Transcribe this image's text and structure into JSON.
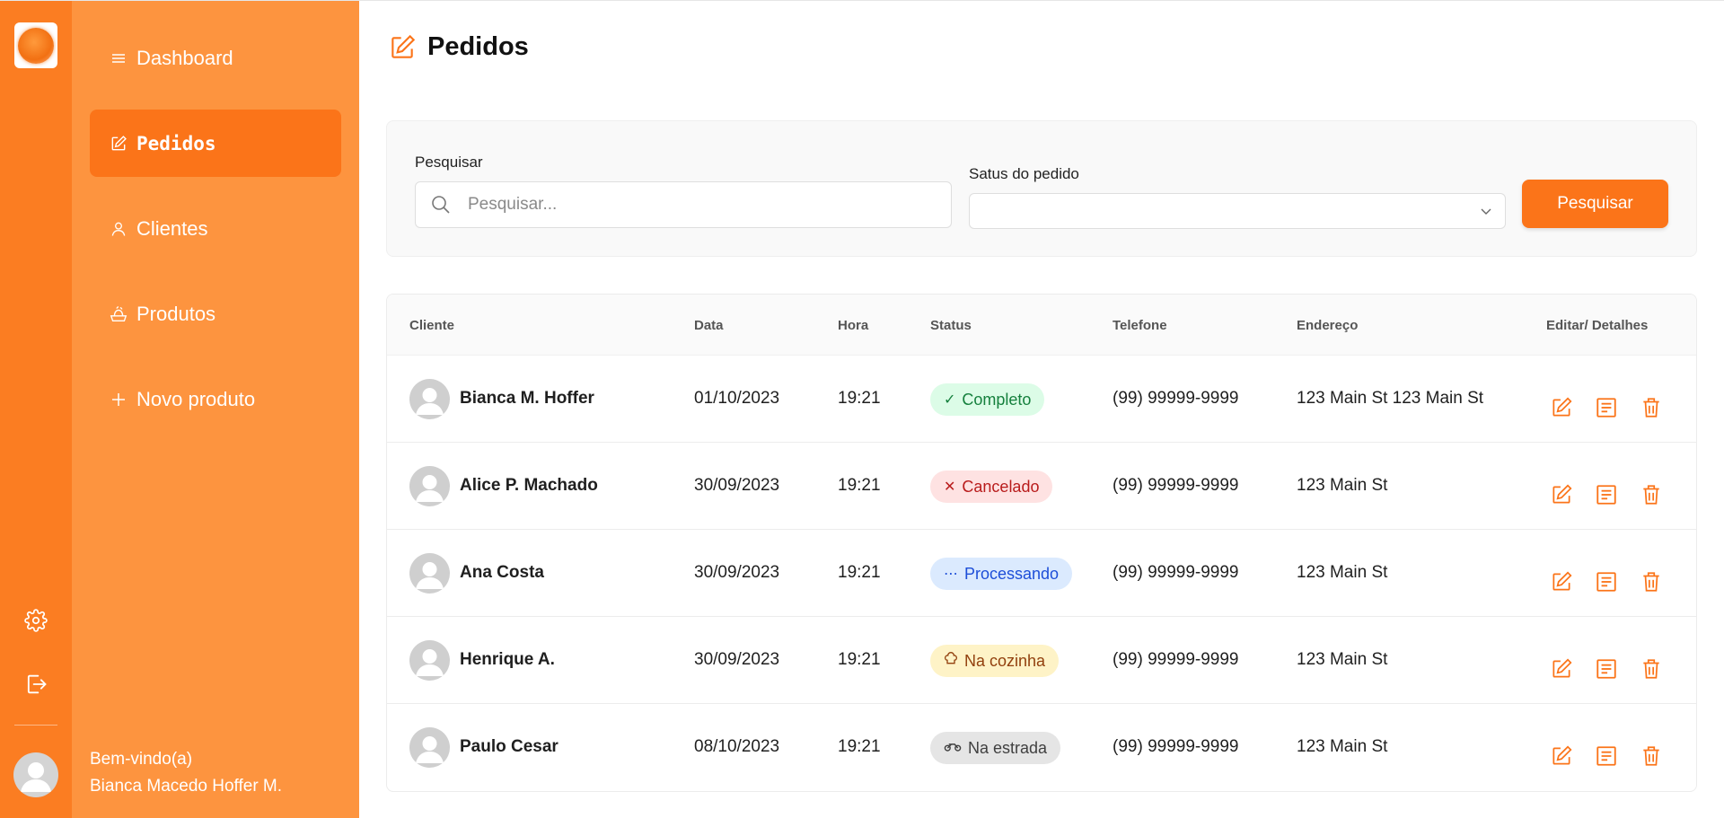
{
  "rail": {
    "icons": [
      "logo",
      "gear-icon",
      "logout-icon",
      "avatar"
    ]
  },
  "sidebar": {
    "items": [
      {
        "label": "Dashboard",
        "icon": "menu-icon"
      },
      {
        "label": "Pedidos",
        "icon": "edit-icon",
        "active": true
      },
      {
        "label": "Clientes",
        "icon": "user-icon"
      },
      {
        "label": "Produtos",
        "icon": "food-icon"
      },
      {
        "label": "Novo produto",
        "icon": "plus-icon"
      }
    ],
    "welcome": "Bem-vindo(a)",
    "user_name": "Bianca Macedo Hoffer M."
  },
  "page": {
    "title": "Pedidos"
  },
  "search": {
    "label": "Pesquisar",
    "placeholder": "Pesquisar...",
    "value": "",
    "status_label": "Satus do pedido",
    "status_value": "",
    "button_label": "Pesquisar"
  },
  "table": {
    "headers": {
      "cliente": "Cliente",
      "data": "Data",
      "hora": "Hora",
      "status": "Status",
      "telefone": "Telefone",
      "endereco": "Endereço",
      "acoes": "Editar/ Detalhes"
    },
    "rows": [
      {
        "cliente": "Bianca M. Hoffer",
        "data": "01/10/2023",
        "hora": "19:21",
        "status": "Completo",
        "status_symbol": "✓",
        "telefone": "(99) 99999-9999",
        "endereco": "123 Main St 123 Main St"
      },
      {
        "cliente": "Alice P. Machado",
        "data": "30/09/2023",
        "hora": "19:21",
        "status": "Cancelado",
        "status_symbol": "✕",
        "telefone": "(99) 99999-9999",
        "endereco": "123 Main St"
      },
      {
        "cliente": "Ana Costa",
        "data": "30/09/2023",
        "hora": "19:21",
        "status": "Processando",
        "status_symbol": "⋯",
        "telefone": "(99) 99999-9999",
        "endereco": "123 Main St"
      },
      {
        "cliente": "Henrique A.",
        "data": "30/09/2023",
        "hora": "19:21",
        "status": "Na cozinha",
        "status_symbol": "chef-hat-icon",
        "telefone": "(99) 99999-9999",
        "endereco": "123 Main St"
      },
      {
        "cliente": "Paulo Cesar",
        "data": "08/10/2023",
        "hora": "19:21",
        "status": "Na estrada",
        "status_symbol": "motorcycle-icon",
        "telefone": "(99) 99999-9999",
        "endereco": "123 Main St"
      }
    ]
  },
  "colors": {
    "rail": "#fb7d22",
    "sidebar": "#fd943f",
    "accent": "#fb7419",
    "completo_bg": "#dcfce7",
    "completo_fg": "#15803d",
    "cancelado_bg": "#fee2e2",
    "cancelado_fg": "#b91c1c",
    "processando_bg": "#dbeafe",
    "processando_fg": "#1d4ed8",
    "cozinha_bg": "#fef3c7",
    "cozinha_fg": "#92400e",
    "estrada_bg": "#e5e5e5",
    "estrada_fg": "#404040"
  }
}
